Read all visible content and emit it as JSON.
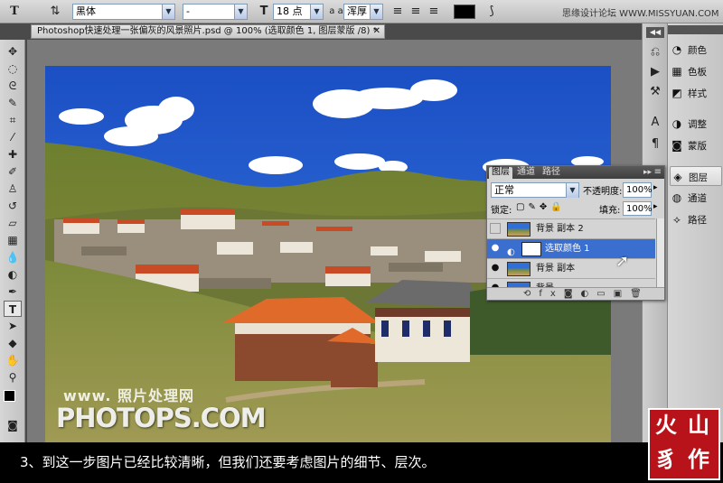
{
  "options_bar": {
    "tool_letter": "T",
    "font_family": "黑体",
    "font_style": "-",
    "font_size": "18 点",
    "aa_label": "a a",
    "aa_mode": "浑厚",
    "text_color": "#000000"
  },
  "site_watermark": "思缘设计论坛 WWW.MISSYUAN.COM",
  "document_tab": {
    "title": "Photoshop快速处理一张偏灰的风景照片.psd @ 100% (选取颜色 1, 图层蒙版 /8) *",
    "close": "✕"
  },
  "tools": [
    "move",
    "marquee",
    "lasso",
    "quick-select",
    "crop",
    "eyedropper",
    "healing",
    "brush",
    "stamp",
    "history-brush",
    "eraser",
    "gradient",
    "blur",
    "dodge",
    "pen",
    "type",
    "path-select",
    "shape",
    "hand",
    "zoom"
  ],
  "dock": {
    "labels": [
      "颜色",
      "色板",
      "样式",
      "调整",
      "蒙版",
      "图层",
      "通道",
      "路径"
    ],
    "active": "图层"
  },
  "layers_panel": {
    "tabs": [
      "图层",
      "通道",
      "路径"
    ],
    "blend_mode": "正常",
    "opacity_label": "不透明度:",
    "opacity_value": "100%",
    "lock_label": "锁定:",
    "fill_label": "填充:",
    "fill_value": "100%",
    "layers": [
      {
        "name": "背景 副本 2",
        "visible": false,
        "selected": false
      },
      {
        "name": "选取颜色 1",
        "visible": true,
        "selected": true
      },
      {
        "name": "背景 副本",
        "visible": true,
        "selected": false
      },
      {
        "name": "背景",
        "visible": true,
        "selected": false
      }
    ]
  },
  "watermark": {
    "line1": "www. 照片处理网",
    "line2": "PHOTOPS.COM"
  },
  "seal_chars": [
    "火",
    "山",
    "豸",
    "作"
  ],
  "caption": "3、到这一步图片已经比较清晰，但我们还要考虑图片的细节、层次。",
  "colors": {
    "sky": "#2459c8",
    "selection": "#3a6fd0",
    "seal": "#b8131a"
  }
}
